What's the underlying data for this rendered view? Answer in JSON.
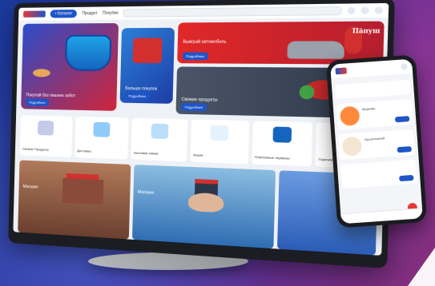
{
  "desktop": {
    "nav": {
      "logo_text": "Шинжилт",
      "pill_label": "• Каталог",
      "links": [
        "Продукт",
        "Покупки"
      ],
      "search_placeholder": ""
    },
    "hero": {
      "card1": {
        "title": "Покупай без лишних забот",
        "button": "Подробнее"
      },
      "card2": {
        "title": "Больше покупок",
        "button": "Подробнее"
      },
      "card3": {
        "title": "Выиграй автомобиль",
        "subtitle": "",
        "script": "Пăпуш",
        "button": "Подробнее"
      },
      "card4": {
        "title": "Свежие продукты",
        "button": "Подробнее"
      }
    },
    "tiles": [
      {
        "label": "Свежие Продукты"
      },
      {
        "label": "Доставка"
      },
      {
        "label": "Бытовая химия"
      },
      {
        "label": "Акции"
      },
      {
        "label": "Платежные сервисы"
      },
      {
        "label": "Горячая линия"
      }
    ],
    "bottom": {
      "b1_label": "Магазин",
      "b2_label": "Магазин"
    }
  },
  "phone": {
    "items": [
      {
        "title": "Морковь",
        "price": "1 кг"
      },
      {
        "title": "Лук репчатый",
        "price": "1 кг"
      }
    ]
  },
  "colors": {
    "brand_blue": "#1e55c8",
    "brand_red": "#e53935"
  }
}
